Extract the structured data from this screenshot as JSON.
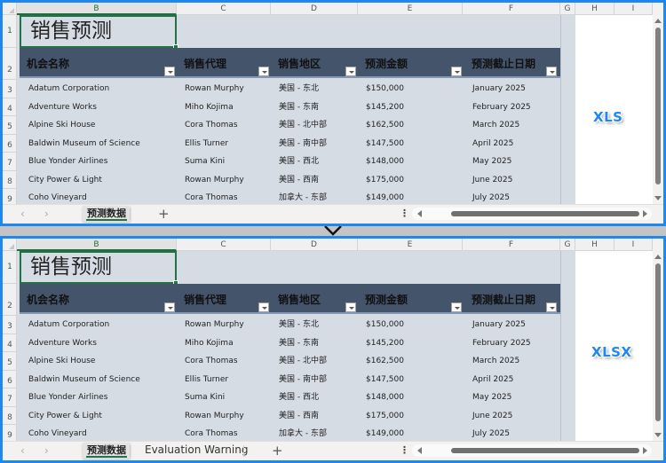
{
  "columns": [
    "B",
    "C",
    "D",
    "E",
    "F",
    "G",
    "H",
    "I"
  ],
  "selected_column": "B",
  "title": "销售预测",
  "headers": [
    "机会名称",
    "销售代理",
    "销售地区",
    "预测金额",
    "预测截止日期"
  ],
  "rows": [
    {
      "num": "3",
      "name": "Adatum Corporation",
      "agent": "Rowan Murphy",
      "region": "美国 - 东北",
      "amount": "$150,000",
      "date": "January 2025"
    },
    {
      "num": "4",
      "name": "Adventure Works",
      "agent": "Miho Kojima",
      "region": "美国 - 东南",
      "amount": "$145,200",
      "date": "February 2025"
    },
    {
      "num": "5",
      "name": "Alpine Ski House",
      "agent": "Cora Thomas",
      "region": "美国 - 北中部",
      "amount": "$162,500",
      "date": "March 2025"
    },
    {
      "num": "6",
      "name": "Baldwin Museum of Science",
      "agent": "Ellis Turner",
      "region": "美国 - 南中部",
      "amount": "$147,500",
      "date": "April 2025"
    },
    {
      "num": "7",
      "name": "Blue Yonder Airlines",
      "agent": "Suma Kini",
      "region": "美国 - 西北",
      "amount": "$148,000",
      "date": "May 2025"
    },
    {
      "num": "8",
      "name": "City Power & Light",
      "agent": "Rowan Murphy",
      "region": "美国 - 西南",
      "amount": "$175,000",
      "date": "June 2025"
    },
    {
      "num": "9",
      "name": "Coho Vineyard",
      "agent": "Cora Thomas",
      "region": "加拿大 - 东部",
      "amount": "$149,000",
      "date": "July 2025"
    }
  ],
  "row_numbers_header": [
    "1",
    "2"
  ],
  "top_panel": {
    "badge": "XLS",
    "tabs": [
      "预测数据"
    ],
    "active_tab": "预测数据"
  },
  "bottom_panel": {
    "badge": "XLSX",
    "tabs": [
      "预测数据",
      "Evaluation Warning"
    ],
    "active_tab": "预测数据"
  },
  "tabbar": {
    "prev_icon": "‹",
    "next_icon": "›",
    "add_icon": "+",
    "more_icon": "⋮"
  },
  "colors": {
    "accent_border": "#1e88f0",
    "header_fill": "#44546a",
    "body_fill": "#d6dce4",
    "selection": "#217346"
  }
}
